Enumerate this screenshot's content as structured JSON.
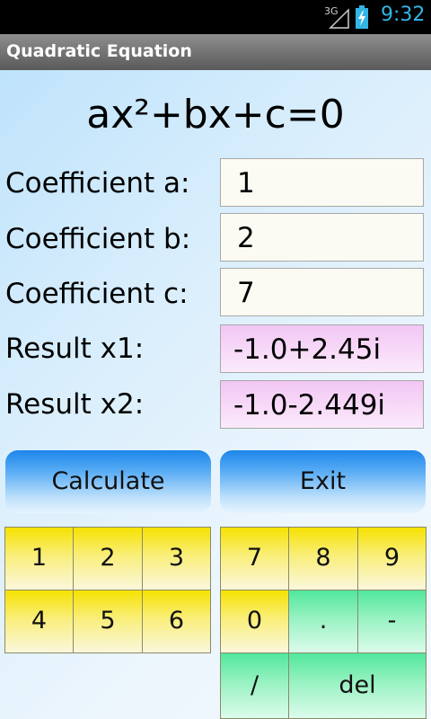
{
  "status_bar": {
    "network": "3G",
    "time": "9:32"
  },
  "app": {
    "title": "Quadratic Equation"
  },
  "equation": "ax²+bx+c=0",
  "coefficients": [
    {
      "label": "Coefficient a:",
      "value": "1"
    },
    {
      "label": "Coefficient b:",
      "value": "2"
    },
    {
      "label": "Coefficient c:",
      "value": "7"
    }
  ],
  "results": [
    {
      "label": "Result x1:",
      "value": "-1.0+2.45i"
    },
    {
      "label": "Result x2:",
      "value": "-1.0-2.449i"
    }
  ],
  "buttons": {
    "calculate": "Calculate",
    "exit": "Exit"
  },
  "keypad": {
    "left": [
      "1",
      "2",
      "3",
      "4",
      "5",
      "6"
    ],
    "right": [
      "7",
      "8",
      "9",
      "0",
      ".",
      "-",
      "/",
      "del"
    ]
  },
  "colors": {
    "clock": "#33b5e5",
    "number_key": "#f6e200",
    "op_key": "#52e79c",
    "result_field": "#f2c6f4",
    "main_button": "#1d86ea"
  }
}
